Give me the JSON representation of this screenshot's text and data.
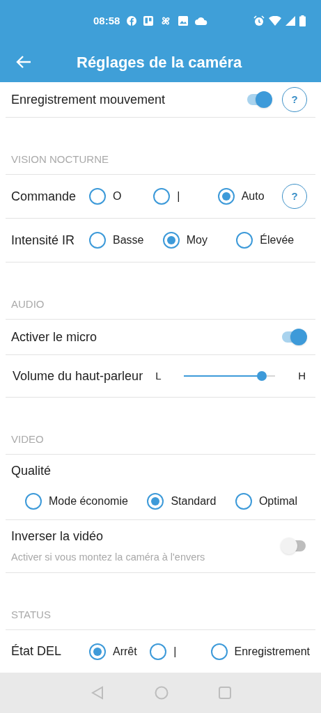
{
  "status_bar": {
    "time": "08:58"
  },
  "app_bar": {
    "title": "Réglages de la caméra"
  },
  "sections": [
    {
      "rows": [
        {
          "kind": "toggle",
          "label": "Enregistrement mouvement",
          "on": true,
          "help": "?"
        }
      ]
    },
    {
      "title": "VISION NOCTURNE",
      "rows": [
        {
          "kind": "radio",
          "label": "Commande",
          "help": "?",
          "options": [
            {
              "label": "O",
              "selected": false
            },
            {
              "label": "|",
              "selected": false
            },
            {
              "label": "Auto",
              "selected": true
            }
          ]
        },
        {
          "kind": "radio",
          "label": "Intensité IR",
          "options": [
            {
              "label": "Basse",
              "selected": false
            },
            {
              "label": "Moy",
              "selected": true
            },
            {
              "label": "Élevée",
              "selected": false
            }
          ]
        }
      ]
    },
    {
      "title": "AUDIO",
      "rows": [
        {
          "kind": "toggle",
          "label": "Activer le micro",
          "on": true
        },
        {
          "kind": "slider",
          "label": "Volume du haut-parleur",
          "min_label": "L",
          "max_label": "H",
          "level": 0.85
        }
      ]
    },
    {
      "title": "VIDEO",
      "rows": [
        {
          "kind": "radio_stacked",
          "label": "Qualité",
          "options": [
            {
              "label": "Mode économie",
              "selected": false
            },
            {
              "label": "Standard",
              "selected": true
            },
            {
              "label": "Optimal",
              "selected": false
            }
          ]
        },
        {
          "kind": "toggle",
          "label": "Inverser la vidéo",
          "description": "Activer si vous montez la caméra à l'envers",
          "on": false
        }
      ]
    },
    {
      "title": "STATUS",
      "rows": [
        {
          "kind": "radio",
          "label": "État DEL",
          "options": [
            {
              "label": "Arrêt",
              "selected": true
            },
            {
              "label": "|",
              "selected": false
            },
            {
              "label": "Enregistrement",
              "selected": false
            }
          ]
        }
      ]
    }
  ]
}
